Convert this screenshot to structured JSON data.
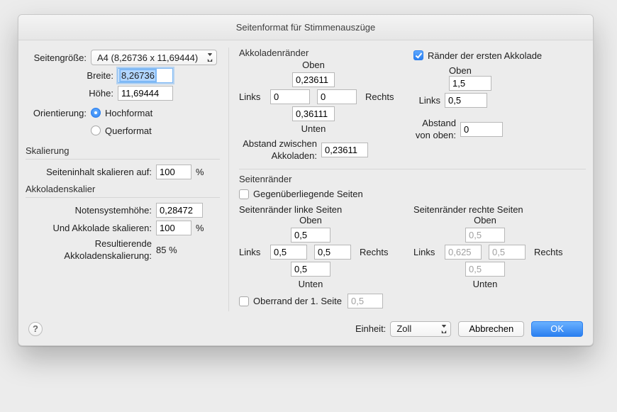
{
  "title": "Seitenformat für Stimmenauszüge",
  "page": {
    "size_label": "Seitengröße:",
    "size_value": "A4 (8,26736 x 11,69444)",
    "width_label": "Breite:",
    "width_value": "8,26736",
    "height_label": "Höhe:",
    "height_value": "11,69444"
  },
  "orientation": {
    "label": "Orientierung:",
    "portrait": "Hochformat",
    "landscape": "Querformat"
  },
  "scaling": {
    "title": "Skalierung",
    "scale_page_label": "Seiteninhalt skalieren auf:",
    "scale_page_value": "100",
    "percent": "%",
    "accolade_title": "Akkoladenskalier",
    "staff_height_label": "Notensystemhöhe:",
    "staff_height_value": "0,28472",
    "scale_accolade_label": "Und Akkolade skalieren:",
    "scale_accolade_value": "100",
    "result_label_1": "Resultierende",
    "result_label_2": "Akkoladenskalierung:",
    "result_value": "85 %"
  },
  "sys_margins": {
    "title": "Akkoladenränder",
    "top_label": "Oben",
    "top_value": "0,23611",
    "left_label": "Links",
    "left_value": "0",
    "right_label": "Rechts",
    "right_value": "0",
    "bottom_label": "Unten",
    "bottom_value": "0,36111",
    "between_label_1": "Abstand zwischen",
    "between_label_2": "Akkoladen:",
    "between_value": "0,23611"
  },
  "first_sys": {
    "check_label": "Ränder der ersten Akkolade",
    "top_label": "Oben",
    "top_value": "1,5",
    "left_label": "Links",
    "left_value": "0,5",
    "dist_label_1": "Abstand",
    "dist_label_2": "von oben:",
    "dist_value": "0"
  },
  "page_margins": {
    "title": "Seitenränder",
    "facing_label": "Gegenüberliegende Seiten",
    "left_title": "Seitenränder linke Seiten",
    "right_title": "Seitenränder rechte Seiten",
    "top_label": "Oben",
    "left_label": "Links",
    "right_label": "Rechts",
    "bottom_label": "Unten",
    "left_page": {
      "top": "0,5",
      "left": "0,5",
      "right": "0,5",
      "bottom": "0,5"
    },
    "right_page": {
      "top": "0,5",
      "left": "0,625",
      "right": "0,5",
      "bottom": "0,5"
    },
    "first_top_label": "Oberrand der 1. Seite",
    "first_top_value": "0,5"
  },
  "footer": {
    "unit_label": "Einheit:",
    "unit_value": "Zoll",
    "cancel": "Abbrechen",
    "ok": "OK"
  }
}
